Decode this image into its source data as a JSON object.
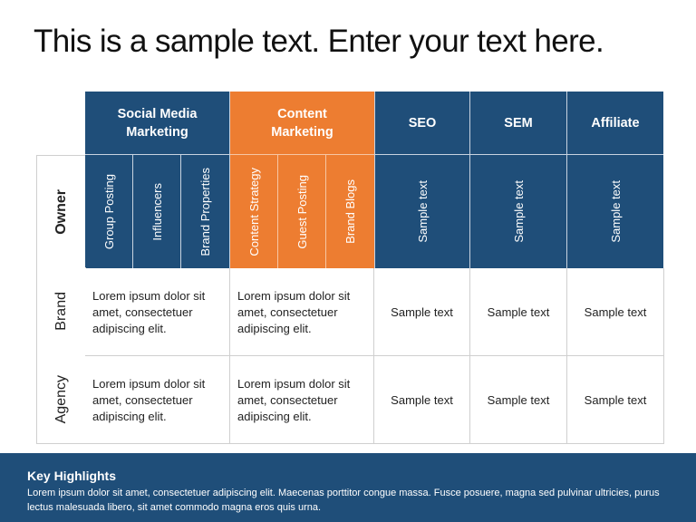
{
  "title": "This is a sample text. Enter your text here.",
  "colors": {
    "blue": "#1f4e79",
    "orange": "#ed7d31"
  },
  "header_groups": [
    {
      "label": "Social Media Marketing",
      "color": "blue",
      "subheaders": [
        "Group Posting",
        "Influencers",
        "Brand Properties"
      ]
    },
    {
      "label": "Content Marketing",
      "color": "orange",
      "subheaders": [
        "Content Strategy",
        "Guest Posting",
        "Brand Blogs"
      ]
    },
    {
      "label": "SEO",
      "color": "blue",
      "subheaders": [
        "Sample text"
      ]
    },
    {
      "label": "SEM",
      "color": "blue",
      "subheaders": [
        "Sample text"
      ]
    },
    {
      "label": "Affiliate",
      "color": "blue",
      "subheaders": [
        "Sample text"
      ]
    }
  ],
  "row_labels": {
    "owner": "Owner",
    "brand": "Brand",
    "agency": "Agency"
  },
  "rows": [
    {
      "label": "Brand",
      "cells": [
        "Lorem ipsum dolor sit amet, consectetuer adipiscing elit.",
        "Lorem ipsum dolor sit amet, consectetuer adipiscing elit.",
        "Sample text",
        "Sample text",
        "Sample text"
      ]
    },
    {
      "label": "Agency",
      "cells": [
        "Lorem ipsum dolor sit amet, consectetuer adipiscing elit.",
        "Lorem ipsum dolor sit amet, consectetuer adipiscing elit.",
        "Sample text",
        "Sample text",
        "Sample text"
      ]
    }
  ],
  "footer": {
    "heading": "Key Highlights",
    "text": "Lorem ipsum dolor sit amet, consectetuer adipiscing elit. Maecenas porttitor congue massa. Fusce posuere, magna sed pulvinar ultricies, purus lectus malesuada libero, sit amet commodo magna eros quis urna."
  }
}
